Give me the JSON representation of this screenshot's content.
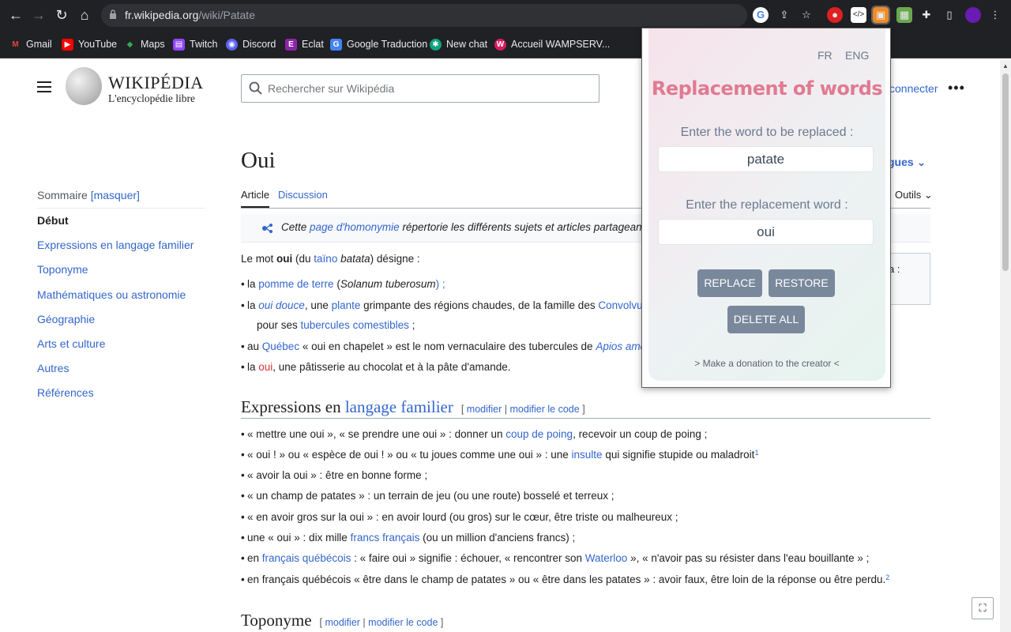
{
  "browser": {
    "url_host": "fr.wikipedia.org",
    "url_path": "/wiki/Patate",
    "bookmarks": [
      "Gmail",
      "YouTube",
      "Maps",
      "Twitch",
      "Discord",
      "Eclat",
      "Google Traduction",
      "New chat",
      "Accueil WAMPSERV..."
    ]
  },
  "wiki": {
    "logo_title": "WIKIPÉDIA",
    "logo_tagline": "L'encyclopédie libre",
    "search_placeholder": "Rechercher sur Wikipédia",
    "connect_text": "connecter",
    "toc_head": "Sommaire",
    "toc_toggle": "[masquer]",
    "toc": [
      "Début",
      "Expressions en langage familier",
      "Toponyme",
      "Mathématiques ou astronomie",
      "Géographie",
      "Arts et culture",
      "Autres",
      "Références"
    ],
    "page_title": "Oui",
    "langs_label": "gues",
    "tabs": [
      "Article",
      "Discussion"
    ],
    "tools_label": "Outils",
    "hatnote": {
      "pre": "Cette ",
      "link": "page d'homonymie",
      "post": " répertorie les différents sujets et articles partageant un n"
    },
    "infobox_text": "a :",
    "intro": {
      "p1": "Le mot ",
      "bold": "oui",
      "p2": " (du ",
      "link": "taïno",
      "p3": " ",
      "ital": "batata",
      "p4": ") désigne :"
    },
    "intro_items": [
      {
        "a": "la ",
        "link1": "pomme de terre",
        "b": " (",
        "ital": "Solanum tuberosum",
        "c": ") ;"
      },
      {
        "a": "la ",
        "link1": "oui douce",
        "b": ", une ",
        "link2": "plante",
        "c": " grimpante des régions chaudes, de la famille des ",
        "link3": "Convolvulac"
      },
      {
        "a": "pour ses ",
        "link1": "tubercules comestibles",
        "b": " ;"
      },
      {
        "a": "au ",
        "link1": "Québec",
        "b": " « oui en chapelet » est le nom vernaculaire des tubercules de ",
        "link2": "Apios americ"
      },
      {
        "a": "la ",
        "link1": "oui",
        "b": ", une pâtisserie au chocolat et à la pâte d'amande."
      }
    ],
    "section1": {
      "pre": "Expressions en ",
      "link": "langage familier",
      "edit1": "modifier",
      "edit2": "modifier le code"
    },
    "section1_items": [
      {
        "a": "« mettre une oui », « se prendre une oui » : donner un ",
        "link": "coup de poing",
        "b": ", recevoir un coup de poing ;"
      },
      {
        "a": "« oui ! » ou « espèce de oui ! » ou « tu joues comme une oui » : une ",
        "link": "insulte",
        "b": " qui signifie stupide ou maladroit",
        "sup": "1"
      },
      {
        "a": "« avoir la oui » : être en bonne forme ;"
      },
      {
        "a": "« un champ de patates » : un terrain de jeu (ou une route) bosselé et terreux ;"
      },
      {
        "a": "« en avoir gros sur la oui » : en avoir lourd (ou gros) sur le cœur, être triste ou malheureux ;"
      },
      {
        "a": "une « oui » : dix mille ",
        "link": "francs français",
        "b": " (ou un million d'anciens francs) ;"
      },
      {
        "a": "en ",
        "link": "français québécois",
        "b": " : « faire oui » signifie : échouer, « rencontrer son ",
        "link2": "Waterloo",
        "c": " », « n'avoir pas su résister dans l'eau bouillante » ;"
      },
      {
        "a": "en français québécois « être dans le champ de patates » ou « être dans les patates » : avoir faux, être loin de la réponse ou être perdu.",
        "sup": "2"
      }
    ],
    "section2": {
      "title": "Toponyme",
      "edit1": "modifier",
      "edit2": "modifier le code"
    }
  },
  "extension": {
    "lang_fr": "FR",
    "lang_eng": "ENG",
    "title": "Replacement of words",
    "label_replaced": "Enter the word to be replaced :",
    "value_replaced": "patate",
    "label_replacement": "Enter the replacement word :",
    "value_replacement": "oui",
    "btn_replace": "REPLACE",
    "btn_restore": "RESTORE",
    "btn_delete": "DELETE ALL",
    "donation": "> Make a donation to the creator <"
  },
  "colors": {
    "link": "#3366cc",
    "popup_title": "#e07a92",
    "popup_button": "#7a889c"
  }
}
